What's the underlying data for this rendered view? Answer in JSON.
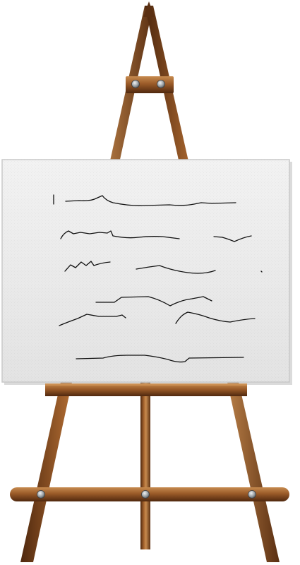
{
  "scene": {
    "subject": "easel-with-canvas",
    "colors": {
      "background": "#ffffff",
      "wood_dark": "#5a2f12",
      "wood_mid": "#8b5228",
      "wood_light": "#c48a50",
      "canvas": "#ececec",
      "canvas_edge": "#c9c9c9",
      "bolt": "#9aa0a4",
      "scribble": "#111111"
    },
    "canvas": {
      "content": "handwritten-scribble-lines",
      "line_count": 6
    }
  }
}
